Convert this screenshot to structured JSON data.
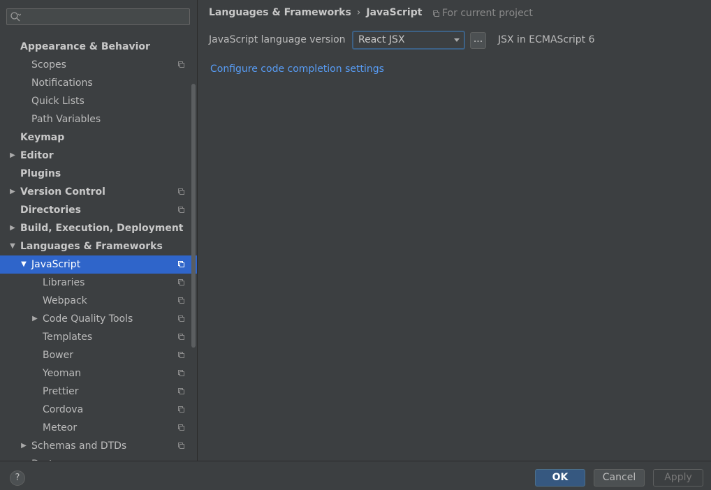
{
  "search": {
    "placeholder": ""
  },
  "sidebar": {
    "items": [
      {
        "label": "Appearance & Behavior",
        "bold": true,
        "indent": 0,
        "arrow": "",
        "proj": false
      },
      {
        "label": "Scopes",
        "bold": false,
        "indent": 1,
        "arrow": "",
        "proj": true
      },
      {
        "label": "Notifications",
        "bold": false,
        "indent": 1,
        "arrow": "",
        "proj": false
      },
      {
        "label": "Quick Lists",
        "bold": false,
        "indent": 1,
        "arrow": "",
        "proj": false
      },
      {
        "label": "Path Variables",
        "bold": false,
        "indent": 1,
        "arrow": "",
        "proj": false
      },
      {
        "label": "Keymap",
        "bold": true,
        "indent": 0,
        "arrow": "",
        "proj": false
      },
      {
        "label": "Editor",
        "bold": true,
        "indent": 0,
        "arrow": "right",
        "proj": false
      },
      {
        "label": "Plugins",
        "bold": true,
        "indent": 0,
        "arrow": "",
        "proj": false
      },
      {
        "label": "Version Control",
        "bold": true,
        "indent": 0,
        "arrow": "right",
        "proj": true
      },
      {
        "label": "Directories",
        "bold": true,
        "indent": 0,
        "arrow": "",
        "proj": true
      },
      {
        "label": "Build, Execution, Deployment",
        "bold": true,
        "indent": 0,
        "arrow": "right",
        "proj": false
      },
      {
        "label": "Languages & Frameworks",
        "bold": true,
        "indent": 0,
        "arrow": "down",
        "proj": false
      },
      {
        "label": "JavaScript",
        "bold": false,
        "indent": 1,
        "arrow": "down",
        "proj": true,
        "selected": true
      },
      {
        "label": "Libraries",
        "bold": false,
        "indent": 2,
        "arrow": "",
        "proj": true
      },
      {
        "label": "Webpack",
        "bold": false,
        "indent": 2,
        "arrow": "",
        "proj": true
      },
      {
        "label": "Code Quality Tools",
        "bold": false,
        "indent": 2,
        "arrow": "right",
        "proj": true
      },
      {
        "label": "Templates",
        "bold": false,
        "indent": 2,
        "arrow": "",
        "proj": true
      },
      {
        "label": "Bower",
        "bold": false,
        "indent": 2,
        "arrow": "",
        "proj": true
      },
      {
        "label": "Yeoman",
        "bold": false,
        "indent": 2,
        "arrow": "",
        "proj": true
      },
      {
        "label": "Prettier",
        "bold": false,
        "indent": 2,
        "arrow": "",
        "proj": true
      },
      {
        "label": "Cordova",
        "bold": false,
        "indent": 2,
        "arrow": "",
        "proj": true
      },
      {
        "label": "Meteor",
        "bold": false,
        "indent": 2,
        "arrow": "",
        "proj": true
      },
      {
        "label": "Schemas and DTDs",
        "bold": false,
        "indent": 1,
        "arrow": "right",
        "proj": true
      },
      {
        "label": "Dart",
        "bold": false,
        "indent": 1,
        "arrow": "",
        "proj": true
      }
    ]
  },
  "breadcrumb": {
    "parent": "Languages & Frameworks",
    "separator": "›",
    "current": "JavaScript"
  },
  "scope": {
    "label": "For current project"
  },
  "settings": {
    "language_label": "JavaScript language version",
    "language_value": "React JSX",
    "more_label": "...",
    "description": "JSX in ECMAScript 6",
    "completion_link": "Configure code completion settings"
  },
  "footer": {
    "help_label": "?",
    "ok_label": "OK",
    "cancel_label": "Cancel",
    "apply_label": "Apply"
  },
  "colors": {
    "selection": "#2f65ca",
    "link": "#589df6",
    "background": "#3c3f41",
    "ok_button": "#365880"
  }
}
